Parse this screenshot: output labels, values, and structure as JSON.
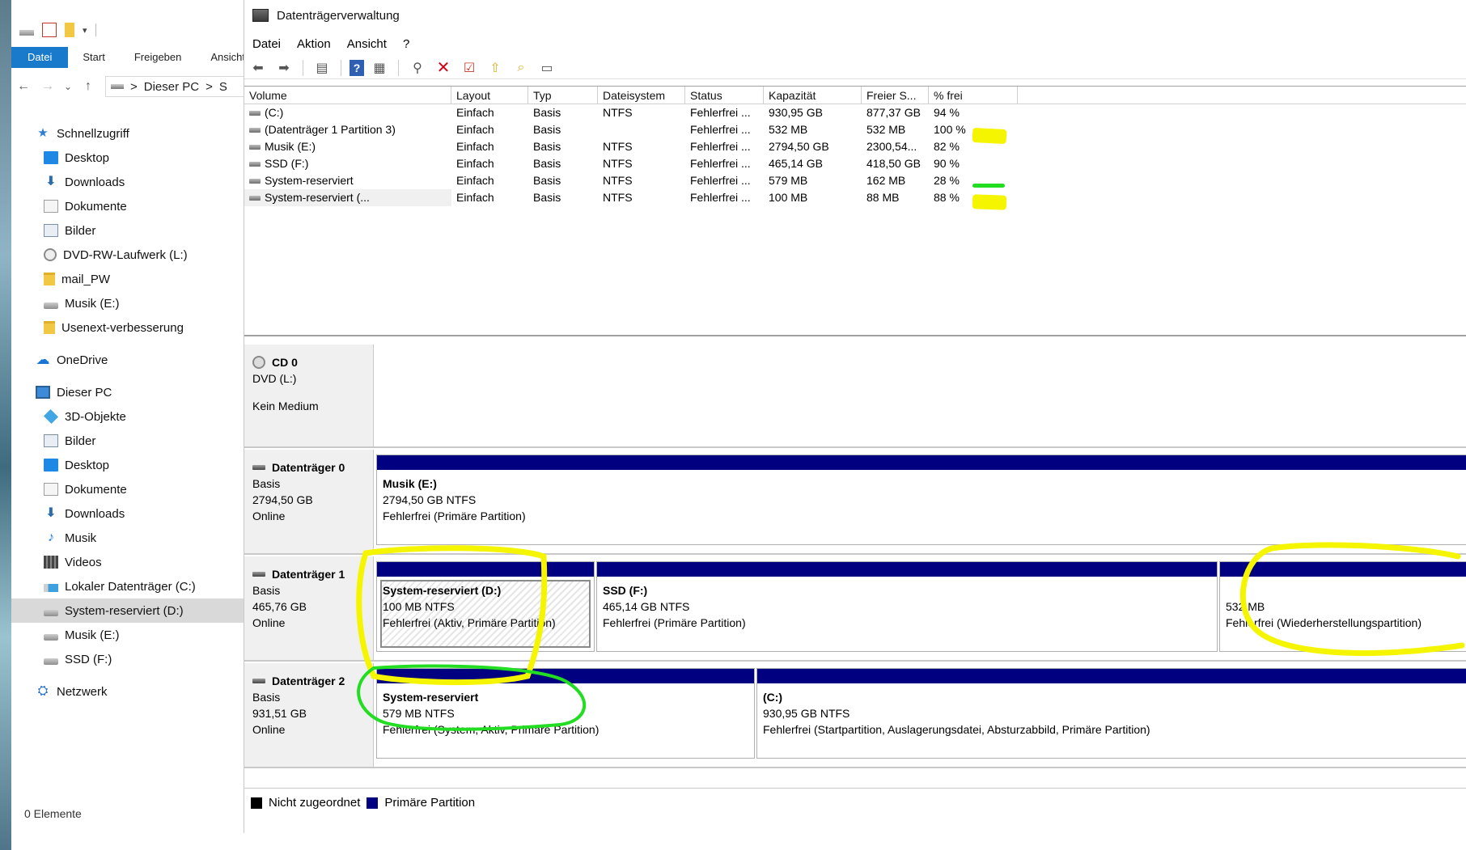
{
  "explorer": {
    "ribbon_tabs": [
      "Datei",
      "Start",
      "Freigeben",
      "Ansicht"
    ],
    "address": {
      "pc": "Dieser PC",
      "separator": ">",
      "next": "S"
    },
    "quick_access": "Schnellzugriff",
    "quick_items": [
      {
        "label": "Desktop",
        "icon": "desktop-icon"
      },
      {
        "label": "Downloads",
        "icon": "downloads-icon"
      },
      {
        "label": "Dokumente",
        "icon": "documents-icon"
      },
      {
        "label": "Bilder",
        "icon": "pictures-icon"
      },
      {
        "label": "DVD-RW-Laufwerk (L:)",
        "icon": "dvd-drive-icon"
      },
      {
        "label": "mail_PW",
        "icon": "folder-icon"
      },
      {
        "label": "Musik (E:)",
        "icon": "drive-icon"
      },
      {
        "label": "Usenext-verbesserung",
        "icon": "folder-icon"
      }
    ],
    "onedrive": "OneDrive",
    "this_pc": "Dieser PC",
    "pc_items": [
      {
        "label": "3D-Objekte",
        "icon": "3d-objects-icon"
      },
      {
        "label": "Bilder",
        "icon": "pictures-icon"
      },
      {
        "label": "Desktop",
        "icon": "desktop-icon"
      },
      {
        "label": "Dokumente",
        "icon": "documents-icon"
      },
      {
        "label": "Downloads",
        "icon": "downloads-icon"
      },
      {
        "label": "Musik",
        "icon": "music-icon"
      },
      {
        "label": "Videos",
        "icon": "videos-icon"
      },
      {
        "label": "Lokaler Datenträger (C:)",
        "icon": "windows-drive-icon"
      },
      {
        "label": "System-reserviert (D:)",
        "icon": "drive-icon",
        "selected": true
      },
      {
        "label": "Musik (E:)",
        "icon": "drive-icon"
      },
      {
        "label": "SSD (F:)",
        "icon": "drive-icon"
      }
    ],
    "network": "Netzwerk",
    "status": "0 Elemente"
  },
  "dm": {
    "title": "Datenträgerverwaltung",
    "menu": [
      "Datei",
      "Aktion",
      "Ansicht",
      "?"
    ],
    "columns": [
      "Volume",
      "Layout",
      "Typ",
      "Dateisystem",
      "Status",
      "Kapazität",
      "Freier S...",
      "% frei"
    ],
    "volumes": [
      {
        "name": "(C:)",
        "layout": "Einfach",
        "typ": "Basis",
        "fs": "NTFS",
        "status": "Fehlerfrei ...",
        "kap": "930,95 GB",
        "frei": "877,37 GB",
        "pct": "94 %"
      },
      {
        "name": "(Datenträger 1 Partition 3)",
        "layout": "Einfach",
        "typ": "Basis",
        "fs": "",
        "status": "Fehlerfrei ...",
        "kap": "532 MB",
        "frei": "532 MB",
        "pct": "100 %"
      },
      {
        "name": "Musik (E:)",
        "layout": "Einfach",
        "typ": "Basis",
        "fs": "NTFS",
        "status": "Fehlerfrei ...",
        "kap": "2794,50 GB",
        "frei": "2300,54...",
        "pct": "82 %"
      },
      {
        "name": "SSD (F:)",
        "layout": "Einfach",
        "typ": "Basis",
        "fs": "NTFS",
        "status": "Fehlerfrei ...",
        "kap": "465,14 GB",
        "frei": "418,50 GB",
        "pct": "90 %"
      },
      {
        "name": "System-reserviert",
        "layout": "Einfach",
        "typ": "Basis",
        "fs": "NTFS",
        "status": "Fehlerfrei ...",
        "kap": "579 MB",
        "frei": "162 MB",
        "pct": "28 %"
      },
      {
        "name": "System-reserviert (...",
        "layout": "Einfach",
        "typ": "Basis",
        "fs": "NTFS",
        "status": "Fehlerfrei ...",
        "kap": "100 MB",
        "frei": "88 MB",
        "pct": "88 %"
      }
    ],
    "cd0": {
      "name": "CD 0",
      "type": "DVD (L:)",
      "status": "Kein Medium"
    },
    "disk0": {
      "name": "Datenträger 0",
      "kind": "Basis",
      "size": "2794,50 GB",
      "state": "Online",
      "p1": {
        "name": "Musik  (E:)",
        "size": "2794,50 GB NTFS",
        "status": "Fehlerfrei (Primäre Partition)"
      }
    },
    "disk1": {
      "name": "Datenträger 1",
      "kind": "Basis",
      "size": "465,76 GB",
      "state": "Online",
      "p1": {
        "name": "System-reserviert  (D:)",
        "size": "100 MB NTFS",
        "status": "Fehlerfrei (Aktiv, Primäre Partition)"
      },
      "p2": {
        "name": "SSD  (F:)",
        "size": "465,14 GB NTFS",
        "status": "Fehlerfrei (Primäre Partition)"
      },
      "p3": {
        "size": "532 MB",
        "status": "Fehlerfrei (Wiederherstellungspartition)"
      }
    },
    "disk2": {
      "name": "Datenträger 2",
      "kind": "Basis",
      "size": "931,51 GB",
      "state": "Online",
      "p1": {
        "name": "System-reserviert",
        "size": "579 MB NTFS",
        "status": "Fehlerfrei (System, Aktiv, Primäre Partition)"
      },
      "p2": {
        "name": "(C:)",
        "size": "930,95 GB NTFS",
        "status": "Fehlerfrei (Startpartition, Auslagerungsdatei, Absturzabbild, Primäre Partition)"
      }
    },
    "legend": {
      "unallocated": "Nicht zugeordnet",
      "primary": "Primäre Partition"
    }
  },
  "colors": {
    "primary_partition": "#000080",
    "unallocated": "#000000",
    "highlight_yellow": "#f5f500",
    "highlight_green": "#22dd22",
    "selection": "#1979ca"
  }
}
